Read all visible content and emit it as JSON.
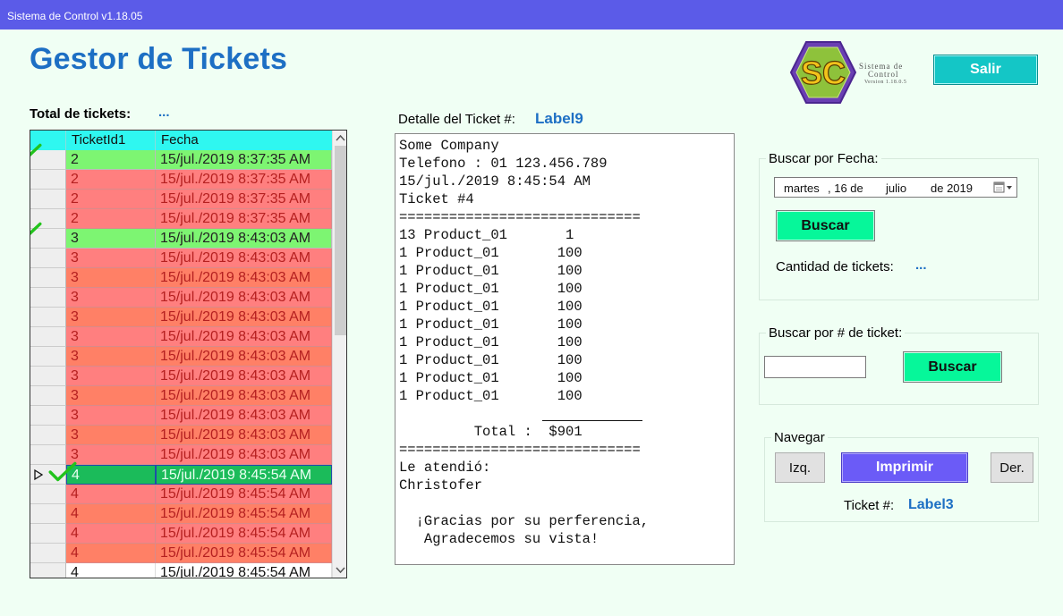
{
  "window": {
    "title": "Sistema de Control v1.18.05"
  },
  "app": {
    "title": "Gestor de Tickets"
  },
  "logo": {
    "letters": "SC",
    "line1": "Sistema de",
    "line2": "Control",
    "line3": "Version 1.18.0.5"
  },
  "header": {
    "exit_label": "Salir"
  },
  "tickets_total": {
    "label": "Total de tickets:",
    "value": "..."
  },
  "grid": {
    "columns": [
      "TicketId1",
      "Fecha"
    ],
    "rows": [
      {
        "id": "2",
        "fecha": "15/jul./2019 8:37:35 AM",
        "status": "green",
        "checked": true
      },
      {
        "id": "2",
        "fecha": "15/jul./2019 8:37:35 AM",
        "status": "red"
      },
      {
        "id": "2",
        "fecha": "15/jul./2019 8:37:35 AM",
        "status": "red"
      },
      {
        "id": "2",
        "fecha": "15/jul./2019 8:37:35 AM",
        "status": "red"
      },
      {
        "id": "3",
        "fecha": "15/jul./2019 8:43:03 AM",
        "status": "green",
        "checked": true
      },
      {
        "id": "3",
        "fecha": "15/jul./2019 8:43:03 AM",
        "status": "red"
      },
      {
        "id": "3",
        "fecha": "15/jul./2019 8:43:03 AM",
        "status": "orange"
      },
      {
        "id": "3",
        "fecha": "15/jul./2019 8:43:03 AM",
        "status": "red"
      },
      {
        "id": "3",
        "fecha": "15/jul./2019 8:43:03 AM",
        "status": "orange"
      },
      {
        "id": "3",
        "fecha": "15/jul./2019 8:43:03 AM",
        "status": "red"
      },
      {
        "id": "3",
        "fecha": "15/jul./2019 8:43:03 AM",
        "status": "orange"
      },
      {
        "id": "3",
        "fecha": "15/jul./2019 8:43:03 AM",
        "status": "red"
      },
      {
        "id": "3",
        "fecha": "15/jul./2019 8:43:03 AM",
        "status": "orange"
      },
      {
        "id": "3",
        "fecha": "15/jul./2019 8:43:03 AM",
        "status": "red"
      },
      {
        "id": "3",
        "fecha": "15/jul./2019 8:43:03 AM",
        "status": "orange"
      },
      {
        "id": "3",
        "fecha": "15/jul./2019 8:43:03 AM",
        "status": "red"
      },
      {
        "id": "4",
        "fecha": "15/jul./2019 8:45:54 AM",
        "status": "current",
        "checked": true,
        "selected": true
      },
      {
        "id": "4",
        "fecha": "15/jul./2019 8:45:54 AM",
        "status": "red"
      },
      {
        "id": "4",
        "fecha": "15/jul./2019 8:45:54 AM",
        "status": "orange"
      },
      {
        "id": "4",
        "fecha": "15/jul./2019 8:45:54 AM",
        "status": "red"
      },
      {
        "id": "4",
        "fecha": "15/jul./2019 8:45:54 AM",
        "status": "orange"
      },
      {
        "id": "4",
        "fecha": "15/jul./2019 8:45:54 AM",
        "status": "white"
      }
    ],
    "colors": {
      "green": "#7df572",
      "red": "#ff7f7f",
      "orange": "#ff8066",
      "current": "#1bbb5a",
      "header": "#2ff7f0"
    }
  },
  "detail": {
    "label": "Detalle del Ticket #:",
    "value": "Label9",
    "lines": [
      "Some Company",
      "Telefono : 01 123.456.789",
      "15/jul./2019 8:45:54 AM",
      "Ticket #4",
      "=============================",
      "13 Product_01       1",
      "1 Product_01       100",
      "1 Product_01       100",
      "1 Product_01       100",
      "1 Product_01       100",
      "1 Product_01       100",
      "1 Product_01       100",
      "1 Product_01       100",
      "1 Product_01       100",
      "1 Product_01       100",
      "",
      "         Total :  $901",
      "=============================",
      "Le atendió:",
      "Christofer",
      "",
      "  ¡Gracias por su perferencia,",
      "   Agradecemos su vista!"
    ]
  },
  "search_date": {
    "legend": "Buscar por Fecha:",
    "date": {
      "weekday": "martes",
      "day": ", 16 de",
      "month": "julio",
      "year": "de 2019"
    },
    "button_label": "Buscar",
    "count_label": "Cantidad de tickets:",
    "count_value": "..."
  },
  "search_ticket": {
    "legend": "Buscar por # de ticket:",
    "input_value": "",
    "button_label": "Buscar"
  },
  "navigate": {
    "legend": "Navegar",
    "prev_label": "Izq.",
    "print_label": "Imprimir",
    "next_label": "Der.",
    "ticket_label": "Ticket #:",
    "ticket_value": "Label3"
  }
}
